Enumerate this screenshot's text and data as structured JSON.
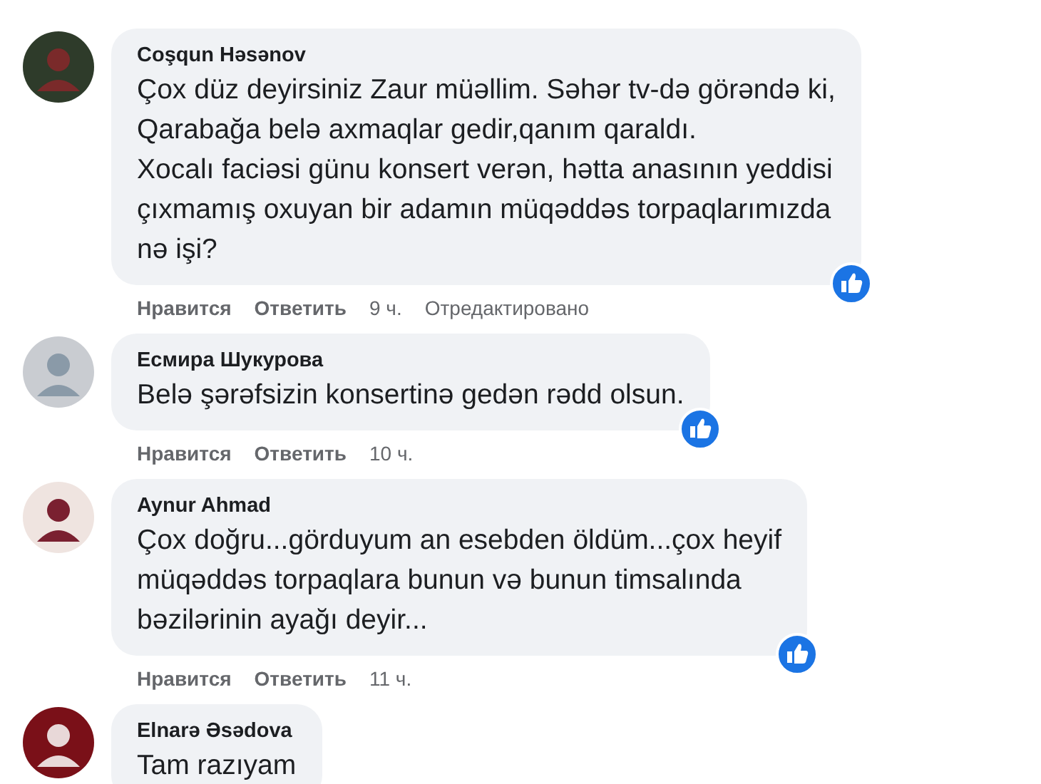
{
  "comments": [
    {
      "author": "Coşqun Həsənov",
      "text": "Çox düz deyirsiniz Zaur müəllim. Səhər tv-də görəndə ki,\nQarabağa belə axmaqlar gedir,qanım qaraldı.\nXocalı faciəsi günu konsert verən, hətta anasının yeddisi\nçıxmamış oxuyan bir adamın müqəddəs torpaqlarımızda\nnə işi?",
      "like_badge": true,
      "actions": {
        "like": "Нравится",
        "reply": "Ответить",
        "time": "9 ч.",
        "edited": "Отредактировано"
      }
    },
    {
      "author": "Есмира Шукурова",
      "text": "Belə şərəfsizin konsertinə gedən rədd olsun.",
      "like_badge": true,
      "actions": {
        "like": "Нравится",
        "reply": "Ответить",
        "time": "10 ч."
      }
    },
    {
      "author": "Aynur Ahmad",
      "text": "Çox doğru...görduyum an esebden öldüm...çox heyif\nmüqəddəs torpaqlara bunun və bunun timsalında\nbəzilərinin ayağı deyir...",
      "like_badge": true,
      "actions": {
        "like": "Нравится",
        "reply": "Ответить",
        "time": "11 ч."
      }
    },
    {
      "author": "Elnarə Əsədova",
      "text": "Tam razıyam",
      "like_badge": false
    }
  ]
}
